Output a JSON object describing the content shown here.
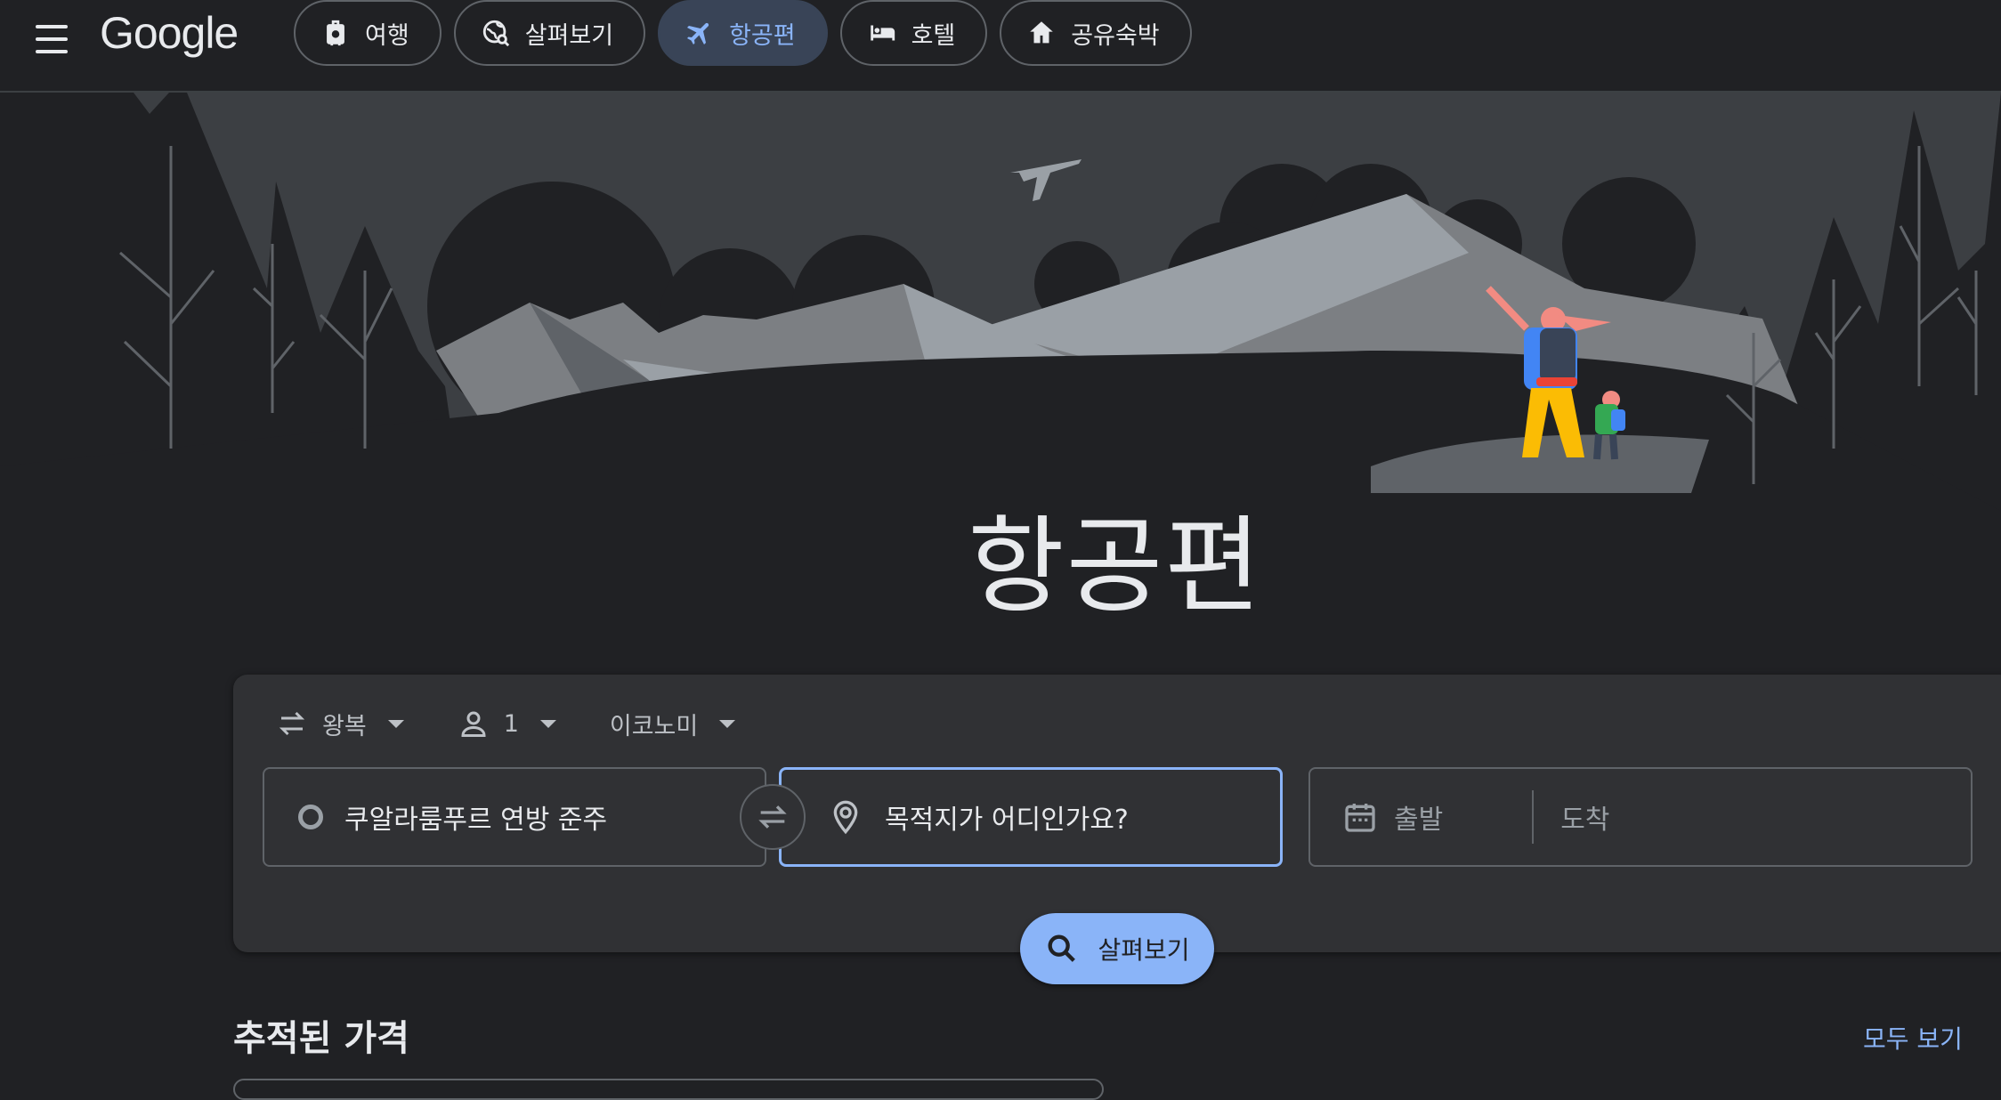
{
  "header": {
    "logo": "Google",
    "tabs": [
      {
        "label": "여행",
        "icon": "luggage-icon",
        "active": false
      },
      {
        "label": "살펴보기",
        "icon": "explore-globe-icon",
        "active": false
      },
      {
        "label": "항공편",
        "icon": "airplane-icon",
        "active": true
      },
      {
        "label": "호텔",
        "icon": "bed-icon",
        "active": false
      },
      {
        "label": "공유숙박",
        "icon": "house-icon",
        "active": false
      }
    ]
  },
  "hero": {
    "title": "항공편"
  },
  "search": {
    "trip_type": "왕복",
    "passengers": "1",
    "cabin_class": "이코노미",
    "origin_value": "쿠알라룸푸르 연방 준주",
    "destination_placeholder": "목적지가 어디인가요?",
    "departure_placeholder": "출발",
    "return_placeholder": "도착",
    "search_button": "살펴보기"
  },
  "tracked": {
    "title": "추적된 가격",
    "see_all": "모두 보기"
  },
  "colors": {
    "background": "#202124",
    "accent": "#8ab4f8",
    "card": "#303134"
  }
}
